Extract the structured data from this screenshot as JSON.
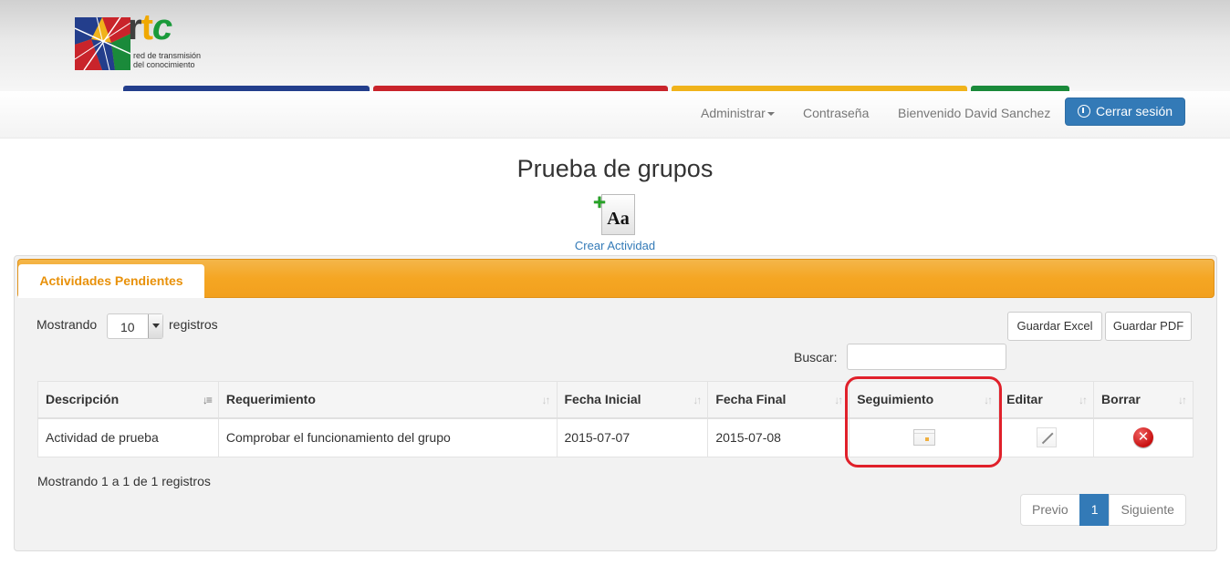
{
  "brand": {
    "letters": {
      "r": "r",
      "t": "t",
      "c": "c"
    },
    "subtitle_line1": "red de transmisión",
    "subtitle_line2": "del conocimiento",
    "colors": {
      "blue": "#233e8c",
      "red": "#c9242b",
      "yellow": "#f0b31b",
      "green": "#1a8a3a"
    }
  },
  "nav": {
    "admin_label": "Administrar",
    "password_label": "Contraseña",
    "welcome_label": "Bienvenido David Sanchez",
    "logout_label": "Cerrar sesión"
  },
  "page": {
    "title": "Prueba de grupos",
    "create_activity_label": "Crear Actividad",
    "create_icon_text": "Aa"
  },
  "panel": {
    "tab_label": "Actividades Pendientes",
    "show_label": "Mostrando",
    "page_size": "10",
    "records_label": "registros",
    "export_excel_label": "Guardar Excel",
    "export_pdf_label": "Guardar PDF",
    "search_label": "Buscar:",
    "search_value": ""
  },
  "table": {
    "headers": [
      "Descripción",
      "Requerimiento",
      "Fecha Inicial",
      "Fecha Final",
      "Seguimiento",
      "Editar",
      "Borrar"
    ],
    "rows": [
      {
        "descripcion": "Actividad de prueba",
        "requerimiento": "Comprobar el funcionamiento del grupo",
        "fecha_inicial": "2015-07-07",
        "fecha_final": "2015-07-08"
      }
    ]
  },
  "footer": {
    "info": "Mostrando 1 a 1 de 1 registros",
    "prev_label": "Previo",
    "current_page": "1",
    "next_label": "Siguiente"
  }
}
